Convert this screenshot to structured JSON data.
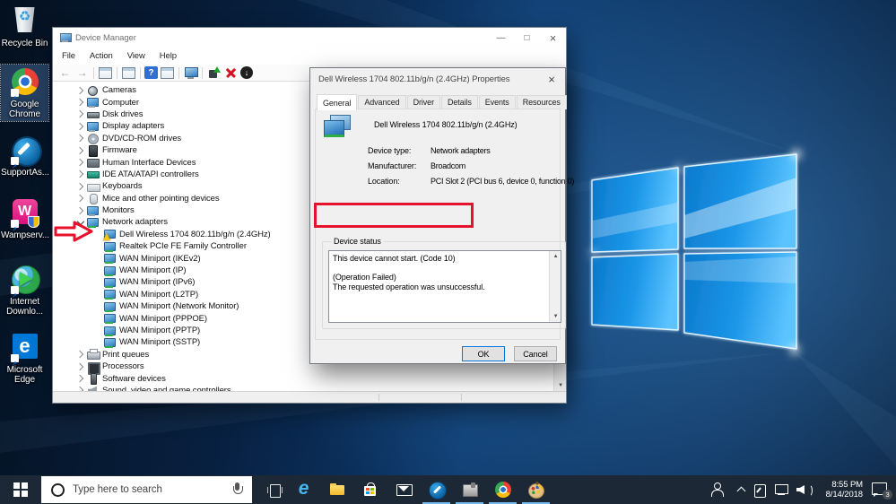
{
  "desktop": {
    "icons": [
      {
        "label": "Recycle Bin",
        "icon": "recycle-bin-icon",
        "selected": "false"
      },
      {
        "label": "Google Chrome",
        "icon": "chrome-icon",
        "selected": "true"
      },
      {
        "label": "SupportAs...",
        "icon": "supportassist-icon",
        "selected": "false"
      },
      {
        "label": "Wampserv...",
        "icon": "wampserver-icon",
        "selected": "false"
      },
      {
        "label": "Internet Downlo...",
        "icon": "internet-download-manager-icon",
        "selected": "false"
      },
      {
        "label": "Microsoft Edge",
        "icon": "edge-icon",
        "selected": "false"
      }
    ]
  },
  "device_manager": {
    "title": "Device Manager",
    "menu": [
      "File",
      "Action",
      "View",
      "Help"
    ],
    "toolbar_icons": [
      "back-icon",
      "forward-icon",
      "console-tree-icon",
      "properties-icon",
      "help-icon",
      "action-pane-icon",
      "scan-hardware-changes-icon",
      "update-driver-icon",
      "uninstall-device-icon",
      "disable-device-icon"
    ],
    "tree": [
      {
        "label": "Cameras",
        "icon": "camera-icon",
        "level": "0",
        "chevron": "right"
      },
      {
        "label": "Computer",
        "icon": "computer-icon",
        "level": "0",
        "chevron": "right"
      },
      {
        "label": "Disk drives",
        "icon": "disk-icon",
        "level": "0",
        "chevron": "right"
      },
      {
        "label": "Display adapters",
        "icon": "display-icon",
        "level": "0",
        "chevron": "right"
      },
      {
        "label": "DVD/CD-ROM drives",
        "icon": "dvd-icon",
        "level": "0",
        "chevron": "right"
      },
      {
        "label": "Firmware",
        "icon": "firmware-icon",
        "level": "0",
        "chevron": "right"
      },
      {
        "label": "Human Interface Devices",
        "icon": "hid-icon",
        "level": "0",
        "chevron": "right"
      },
      {
        "label": "IDE ATA/ATAPI controllers",
        "icon": "ide-icon",
        "level": "0",
        "chevron": "right"
      },
      {
        "label": "Keyboards",
        "icon": "keyboard-icon",
        "level": "0",
        "chevron": "right"
      },
      {
        "label": "Mice and other pointing devices",
        "icon": "mouse-icon",
        "level": "0",
        "chevron": "right"
      },
      {
        "label": "Monitors",
        "icon": "monitor-icon",
        "level": "0",
        "chevron": "right"
      },
      {
        "label": "Network adapters",
        "icon": "network-icon",
        "level": "0",
        "chevron": "down"
      },
      {
        "label": "Dell Wireless 1704 802.11b/g/n (2.4GHz)",
        "icon": "network-adapter-warning-icon",
        "level": "1",
        "chevron": "none"
      },
      {
        "label": "Realtek PCIe FE Family Controller",
        "icon": "network-adapter-icon",
        "level": "1",
        "chevron": "none"
      },
      {
        "label": "WAN Miniport (IKEv2)",
        "icon": "network-adapter-icon",
        "level": "1",
        "chevron": "none"
      },
      {
        "label": "WAN Miniport (IP)",
        "icon": "network-adapter-icon",
        "level": "1",
        "chevron": "none"
      },
      {
        "label": "WAN Miniport (IPv6)",
        "icon": "network-adapter-icon",
        "level": "1",
        "chevron": "none"
      },
      {
        "label": "WAN Miniport (L2TP)",
        "icon": "network-adapter-icon",
        "level": "1",
        "chevron": "none"
      },
      {
        "label": "WAN Miniport (Network Monitor)",
        "icon": "network-adapter-icon",
        "level": "1",
        "chevron": "none"
      },
      {
        "label": "WAN Miniport (PPPOE)",
        "icon": "network-adapter-icon",
        "level": "1",
        "chevron": "none"
      },
      {
        "label": "WAN Miniport (PPTP)",
        "icon": "network-adapter-icon",
        "level": "1",
        "chevron": "none"
      },
      {
        "label": "WAN Miniport (SSTP)",
        "icon": "network-adapter-icon",
        "level": "1",
        "chevron": "none"
      },
      {
        "label": "Print queues",
        "icon": "printer-icon",
        "level": "0",
        "chevron": "right"
      },
      {
        "label": "Processors",
        "icon": "processor-icon",
        "level": "0",
        "chevron": "right"
      },
      {
        "label": "Software devices",
        "icon": "software-icon",
        "level": "0",
        "chevron": "right"
      },
      {
        "label": "Sound, video and game controllers",
        "icon": "sound-icon",
        "level": "0",
        "chevron": "right"
      }
    ]
  },
  "dialog": {
    "title": "Dell Wireless 1704 802.11b/g/n (2.4GHz) Properties",
    "tabs": [
      {
        "label": "General",
        "active": "true"
      },
      {
        "label": "Advanced",
        "active": "false"
      },
      {
        "label": "Driver",
        "active": "false"
      },
      {
        "label": "Details",
        "active": "false"
      },
      {
        "label": "Events",
        "active": "false"
      },
      {
        "label": "Resources",
        "active": "false"
      }
    ],
    "device_name": "Dell Wireless 1704 802.11b/g/n (2.4GHz)",
    "fields": [
      {
        "label": "Device type:",
        "value": "Network adapters"
      },
      {
        "label": "Manufacturer:",
        "value": "Broadcom"
      },
      {
        "label": "Location:",
        "value": "PCI Slot 2 (PCI bus 6, device 0, function 0)"
      }
    ],
    "group_label": "Device status",
    "status_lines": [
      "This device cannot start. (Code 10)",
      "",
      "(Operation Failed)",
      "The requested operation was unsuccessful."
    ],
    "buttons": {
      "ok": "OK",
      "cancel": "Cancel"
    }
  },
  "taskbar": {
    "search_placeholder": "Type here to search",
    "apps": [
      {
        "icon": "edge-icon",
        "running": "false"
      },
      {
        "icon": "file-explorer-icon",
        "running": "false"
      },
      {
        "icon": "store-icon",
        "running": "false"
      },
      {
        "icon": "mail-icon",
        "running": "false"
      },
      {
        "icon": "supportassist-icon",
        "running": "true"
      },
      {
        "icon": "device-manager-icon",
        "running": "true"
      },
      {
        "icon": "chrome-icon",
        "running": "true"
      },
      {
        "icon": "paint-icon",
        "running": "true"
      }
    ],
    "tray": {
      "icons": [
        "people-icon",
        "chevron-up-icon",
        "pen-icon",
        "network-icon",
        "volume-icon",
        "action-center-icon"
      ],
      "time": "8:55 PM",
      "date": "8/14/2018",
      "notification_count": "3"
    }
  },
  "colors": {
    "annotation_red": "#e8112d",
    "taskbar": "#1d2836",
    "running_underline": "#76b9ed",
    "wallpaper_blue": "#1b96e8"
  }
}
